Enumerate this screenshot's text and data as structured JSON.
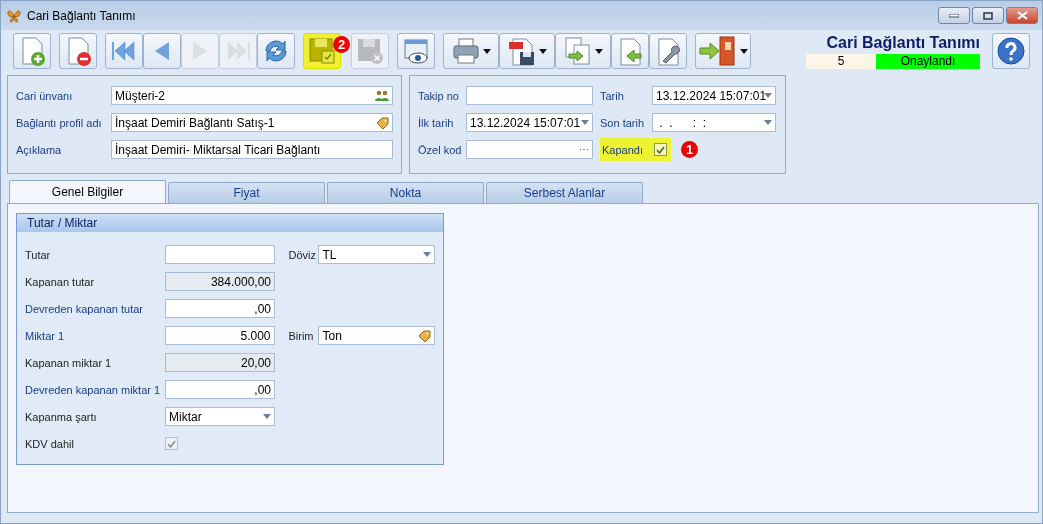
{
  "window": {
    "title": "Cari Bağlantı Tanımı"
  },
  "toolbar_groups": [
    {
      "buttons": [
        {
          "kind": "new",
          "disabled": false,
          "highlighted": false,
          "menu": false
        }
      ]
    },
    {
      "buttons": [
        {
          "kind": "delete",
          "disabled": false,
          "highlighted": false,
          "menu": false
        }
      ]
    },
    {
      "buttons": [
        {
          "kind": "first",
          "disabled": false,
          "highlighted": false,
          "menu": false
        },
        {
          "kind": "prev",
          "disabled": false,
          "highlighted": false,
          "menu": false
        },
        {
          "kind": "next",
          "disabled": true,
          "highlighted": false,
          "menu": false
        },
        {
          "kind": "last",
          "disabled": true,
          "highlighted": false,
          "menu": false
        },
        {
          "kind": "refresh",
          "disabled": false,
          "highlighted": false,
          "menu": false
        }
      ]
    },
    {
      "buttons": [
        {
          "kind": "save",
          "disabled": false,
          "highlighted": true,
          "menu": false,
          "badge": "2"
        },
        {
          "kind": "cancel",
          "disabled": true,
          "highlighted": false,
          "menu": false
        }
      ]
    },
    {
      "buttons": [
        {
          "kind": "preview",
          "disabled": false,
          "highlighted": false,
          "menu": false
        }
      ]
    },
    {
      "buttons": [
        {
          "kind": "print",
          "disabled": false,
          "highlighted": false,
          "menu": true
        },
        {
          "kind": "pdf",
          "disabled": false,
          "highlighted": false,
          "menu": true
        },
        {
          "kind": "copy",
          "disabled": false,
          "highlighted": false,
          "menu": true
        },
        {
          "kind": "import",
          "disabled": false,
          "highlighted": false,
          "menu": false
        },
        {
          "kind": "settings",
          "disabled": false,
          "highlighted": false,
          "menu": false
        }
      ]
    },
    {
      "buttons": [
        {
          "kind": "exit",
          "disabled": false,
          "highlighted": false,
          "menu": true
        }
      ]
    }
  ],
  "header": {
    "title": "Cari Bağlantı Tanımı",
    "number": "5",
    "status": "Onaylandı"
  },
  "left_panel": [
    {
      "label": "Cari ünvanı",
      "value": "Müşteri-2",
      "kind": "lookup"
    },
    {
      "label": "Bağlantı profil adı",
      "value": "İnşaat Demiri Bağlantı Satış-1",
      "kind": "tag"
    },
    {
      "label": "Açıklama",
      "value": "İnşaat Demiri- Miktarsal Ticari Bağlantı",
      "kind": "text"
    }
  ],
  "right_panel": [
    {
      "label": "Takip no",
      "kind": "text"
    },
    {
      "label": "Tarih",
      "kind": "dropdown",
      "value": "13.12.2024 15:07:01"
    },
    {
      "label": "İlk tarih",
      "kind": "dropdown",
      "value": "13.12.2024 15:07:01"
    },
    {
      "label": "Son tarih",
      "kind": "dropdown",
      "value": " .  .      :  :"
    },
    {
      "label": "Özel kod",
      "kind": "ellipsis",
      "value": "···"
    },
    {
      "label": "Kapandı",
      "kind": "checkbox",
      "checked": true,
      "highlighted": true,
      "badge": "1"
    }
  ],
  "tabs": [
    {
      "label": "Genel Bilgiler",
      "selected": true
    },
    {
      "label": "Fiyat",
      "selected": false
    },
    {
      "label": "Nokta",
      "selected": false
    },
    {
      "label": "Serbest Alanlar",
      "selected": false
    }
  ],
  "group": {
    "title": "Tutar / Miktar",
    "rows": [
      {
        "label": "Tutar",
        "color": "#222222",
        "field": {
          "kind": "number",
          "readonly": false
        },
        "side": {
          "label": "Döviz",
          "field": {
            "kind": "dropdown",
            "value": "TL",
            "readonly": false
          }
        }
      },
      {
        "label": "Kapanan tutar",
        "color": "#222222",
        "field": {
          "kind": "number",
          "value": "384.000,00",
          "readonly": true
        }
      },
      {
        "label": "Devreden kapanan tutar",
        "color": "#1a3c8c",
        "field": {
          "kind": "number",
          "value": ",00",
          "readonly": false
        }
      },
      {
        "label": "Miktar 1",
        "color": "#1a3c8c",
        "field": {
          "kind": "number",
          "value": "5.000",
          "readonly": false
        },
        "side": {
          "label": "Birim",
          "field": {
            "kind": "tag",
            "value": "Ton",
            "readonly": false
          }
        }
      },
      {
        "label": "Kapanan miktar 1",
        "color": "#222222",
        "field": {
          "kind": "number",
          "value": "20,00",
          "readonly": true
        }
      },
      {
        "label": "Devreden kapanan miktar 1",
        "color": "#1a3c8c",
        "field": {
          "kind": "number",
          "value": ",00",
          "readonly": false
        }
      },
      {
        "label": "Kapanma şartı",
        "color": "#222222",
        "field": {
          "kind": "dropdown",
          "value": "Miktar",
          "readonly": false
        }
      },
      {
        "label": "KDV dahil",
        "color": "#222222",
        "field": {
          "kind": "checkbox",
          "checked": true,
          "readonly": true
        }
      }
    ]
  }
}
